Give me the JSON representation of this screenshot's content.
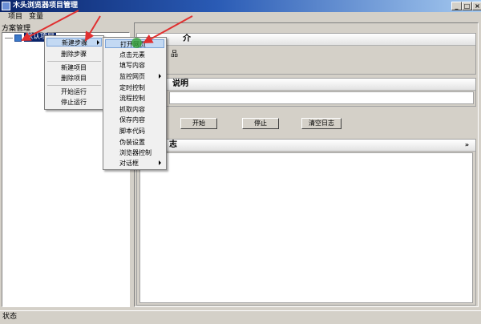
{
  "window": {
    "title": "木头浏览器项目管理",
    "controls": [
      "_",
      "□",
      "×"
    ]
  },
  "menubar": {
    "items": [
      "项目",
      "变量"
    ]
  },
  "left_panel": {
    "section_label": "方案管理",
    "tree_root_label": "默认项目"
  },
  "context_menu": {
    "items": [
      "新建步骤",
      "删除步骤",
      "新建项目",
      "删除项目",
      "开始运行",
      "停止运行"
    ]
  },
  "submenu": {
    "items": [
      "打开网页",
      "点击元素",
      "填写内容",
      "监控网页",
      "定时控制",
      "流程控制",
      "抓取内容",
      "保存内容",
      "脚本代码",
      "伪装设置",
      "浏览器控制",
      "对话框"
    ]
  },
  "right_panel": {
    "intro_header_partial": "介",
    "intro_body_partial": "品",
    "desc_header_partial": "说明",
    "buttons": {
      "start": "开始",
      "stop": "停止",
      "clear_log": "清空日志"
    },
    "log_header_partial": "志",
    "collapse_glyph": "»"
  },
  "statusbar": {
    "text": "状态"
  },
  "colors": {
    "title_bar": "#0a246a",
    "arrow": "#e03030",
    "highlight": "#c3d9f3",
    "cursor": "#2ca02c"
  }
}
